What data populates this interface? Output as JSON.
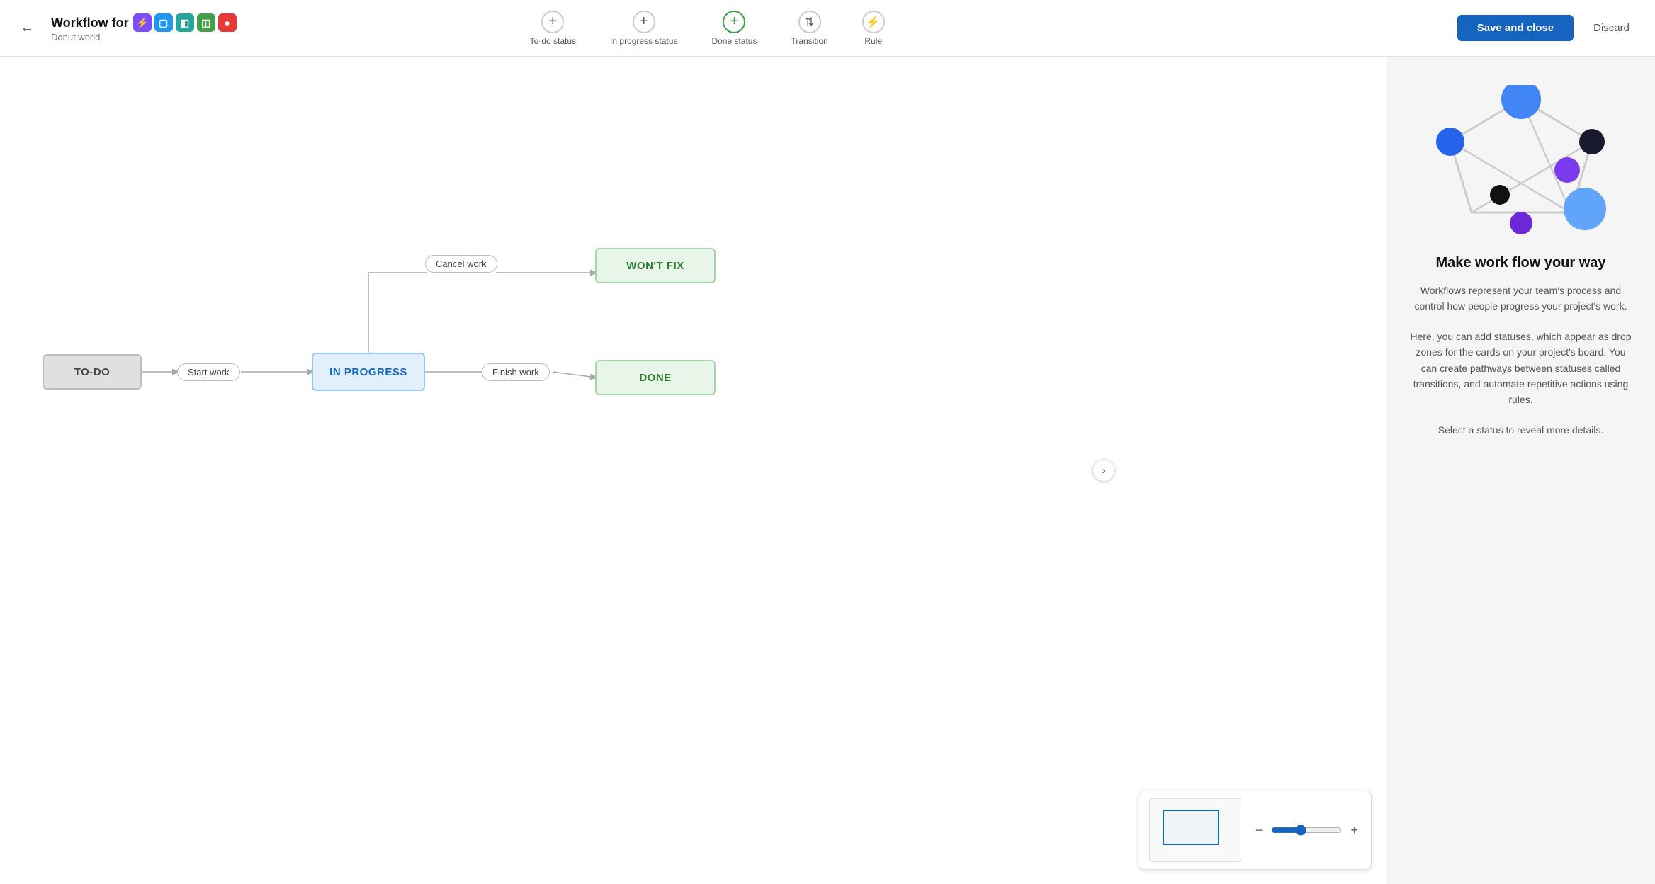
{
  "header": {
    "back_label": "←",
    "title_prefix": "Workflow for",
    "subtitle": "Donut world",
    "app_icons": [
      {
        "color": "purple",
        "symbol": "⚡"
      },
      {
        "color": "blue",
        "symbol": "□"
      },
      {
        "color": "teal",
        "symbol": "◧"
      },
      {
        "color": "green",
        "symbol": "◫"
      },
      {
        "color": "red",
        "symbol": "●"
      }
    ],
    "toolbar": [
      {
        "label": "To-do status",
        "icon_type": "plus",
        "icon_color": "default"
      },
      {
        "label": "In progress status",
        "icon_type": "plus",
        "icon_color": "default"
      },
      {
        "label": "Done status",
        "icon_type": "plus",
        "icon_color": "green"
      },
      {
        "label": "Transition",
        "icon_type": "arrows",
        "icon_color": "default"
      },
      {
        "label": "Rule",
        "icon_type": "bolt",
        "icon_color": "default"
      }
    ],
    "save_label": "Save and close",
    "discard_label": "Discard"
  },
  "workflow": {
    "nodes": [
      {
        "id": "todo",
        "label": "TO-DO"
      },
      {
        "id": "inprogress",
        "label": "IN PROGRESS"
      },
      {
        "id": "wontfix",
        "label": "WON'T FIX"
      },
      {
        "id": "done",
        "label": "DONE"
      }
    ],
    "transitions": [
      {
        "id": "startwork",
        "label": "Start work"
      },
      {
        "id": "cancelwork",
        "label": "Cancel work"
      },
      {
        "id": "finishwork",
        "label": "Finish work"
      }
    ]
  },
  "zoom": {
    "zoom_out_label": "−",
    "zoom_in_label": "+"
  },
  "collapse_btn": "›",
  "panel": {
    "heading": "Make work flow your way",
    "desc1": "Workflows represent your team's process and control how people progress your project's work.",
    "desc2": "Here, you can add statuses, which appear as drop zones for the cards on your project's board. You can create pathways between statuses called transitions, and automate repetitive actions using rules.",
    "desc3": "Select a status to reveal more details."
  }
}
